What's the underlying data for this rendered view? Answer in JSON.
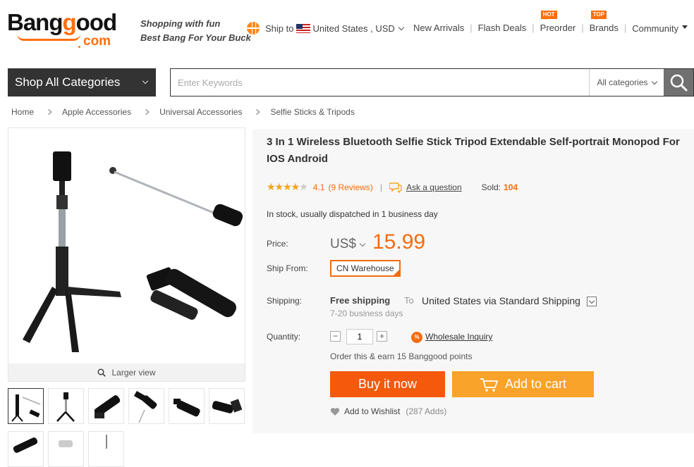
{
  "logo": {
    "word_left": "Bang",
    "word_right": "ood",
    "word_g": "g",
    "domain": "com"
  },
  "tagline": {
    "line1": "Shopping with fun",
    "line2": "Best Bang For Your Buck"
  },
  "ship": {
    "label": "Ship to",
    "country": "United States , USD"
  },
  "topnav": [
    {
      "label": "New Arrivals"
    },
    {
      "label": "Flash Deals"
    },
    {
      "label": "Preorder",
      "badge": "HOT"
    },
    {
      "label": "Brands",
      "badge": "TOP"
    },
    {
      "label": "Community"
    }
  ],
  "search": {
    "shop_all": "Shop All Categories",
    "placeholder": "Enter Keywords",
    "category": "All categories"
  },
  "breadcrumb": [
    "Home",
    "Apple Accessories",
    "Universal Accessories",
    "Selfie Sticks & Tripods"
  ],
  "gallery": {
    "larger_view": "Larger view"
  },
  "product": {
    "title": "3 In 1 Wireless Bluetooth Selfie Stick Tripod Extendable Self-portrait Monopod For IOS Android",
    "rating": "4.1",
    "rating_fraction": 0.82,
    "reviews": "(9 Reviews)",
    "ask": "Ask a question",
    "sold_label": "Sold:",
    "sold": "104",
    "stock": "In stock, usually dispatched in 1 business day",
    "price_label": "Price:",
    "currency": "US$",
    "price": "15.99",
    "shipfrom_label": "Ship From:",
    "warehouse": "CN Warehouse",
    "shipping_label": "Shipping:",
    "free_shipping": "Free shipping",
    "to": "To",
    "ship_dest": "United States via Standard Shipping",
    "days": "7-20 business days",
    "quantity_label": "Quantity:",
    "quantity": "1",
    "minus": "−",
    "plus": "+",
    "wholesale": "Wholesale Inquiry",
    "points": "Order this & earn 15 Banggood points",
    "buy_now": "Buy it now",
    "add_cart": "Add to cart",
    "wishlist": "Add to Wishlist",
    "wishlist_count": "(287 Adds)"
  },
  "colors": {
    "brand_orange": "#f36c10",
    "buy_now": "#f4590c",
    "add_cart": "#f9a32a",
    "dark": "#333333"
  }
}
